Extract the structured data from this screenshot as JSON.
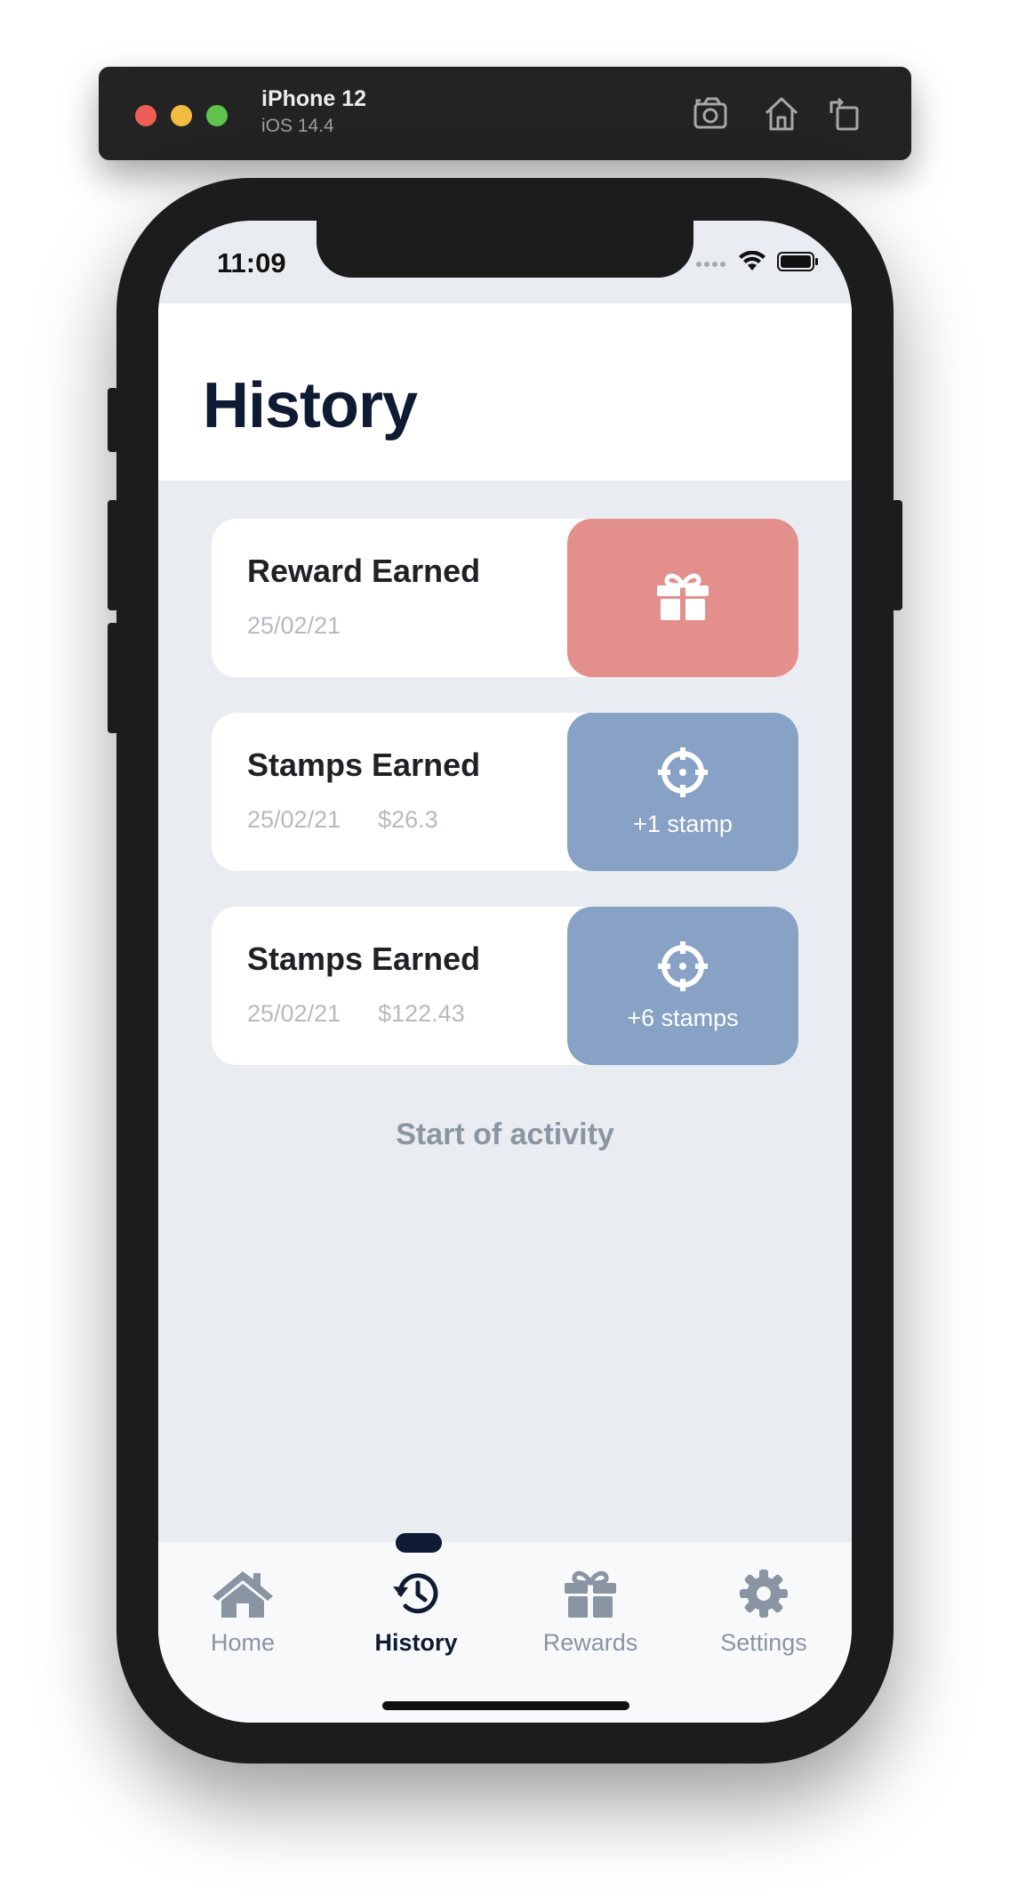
{
  "simulator": {
    "device_name": "iPhone 12",
    "os_version": "iOS 14.4",
    "icons": [
      "screenshot-icon",
      "home-icon",
      "rotate-icon"
    ]
  },
  "status_bar": {
    "time": "11:09"
  },
  "page": {
    "title": "History"
  },
  "activity": [
    {
      "title": "Reward Earned",
      "date": "25/02/21",
      "amount": "",
      "badge_label": "",
      "badge_icon": "gift-icon",
      "badge_color": "#e38f8c"
    },
    {
      "title": "Stamps Earned",
      "date": "25/02/21",
      "amount": "$26.3",
      "badge_label": "+1 stamp",
      "badge_icon": "crosshair-icon",
      "badge_color": "#87a2c5"
    },
    {
      "title": "Stamps Earned",
      "date": "25/02/21",
      "amount": "$122.43",
      "badge_label": "+6 stamps",
      "badge_icon": "crosshair-icon",
      "badge_color": "#87a2c5"
    }
  ],
  "footer_text": "Start of activity",
  "tabs": [
    {
      "label": "Home",
      "icon": "home-icon",
      "active": false
    },
    {
      "label": "History",
      "icon": "history-icon",
      "active": true
    },
    {
      "label": "Rewards",
      "icon": "gift-icon",
      "active": false
    },
    {
      "label": "Settings",
      "icon": "gear-icon",
      "active": false
    }
  ],
  "colors": {
    "primary_dark": "#0f1b33",
    "reward_badge": "#e38f8c",
    "stamp_badge": "#87a2c5",
    "muted": "#8a95a3",
    "background": "#e9ecf0"
  }
}
